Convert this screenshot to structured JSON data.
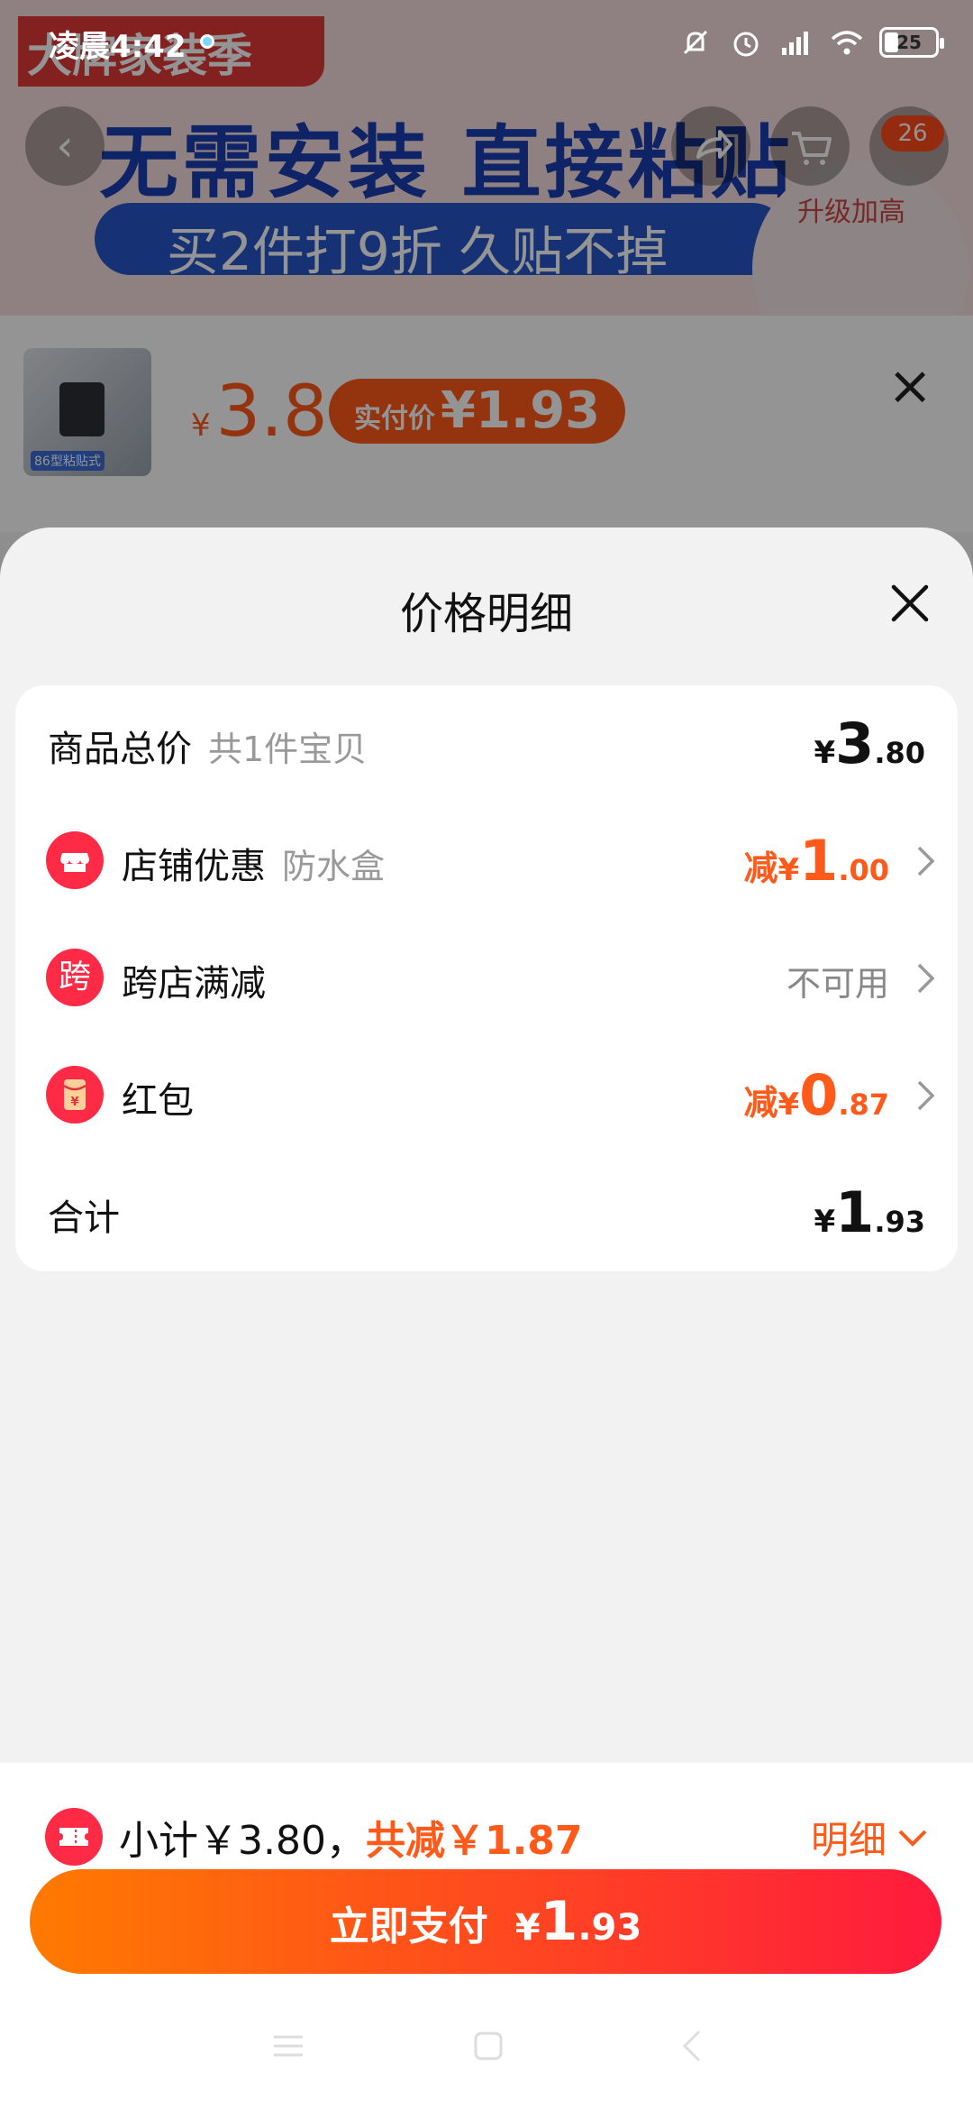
{
  "status_bar": {
    "time": "凌晨4:42",
    "battery": "25"
  },
  "background": {
    "banner_title": "无需安装 直接粘贴",
    "banner_sub": "买2件打9折 久贴不掉",
    "banner_tag": "大牌家装季",
    "upgrade_label": "升级加高",
    "cart_count": "26",
    "thumb_label": "86型粘贴式",
    "price_currency": "¥",
    "price_value": "3.8",
    "pay_label": "实付价",
    "pay_value": "¥1.93"
  },
  "sheet": {
    "title": "价格明细",
    "rows": [
      {
        "label": "商品总价",
        "sub": "共1件宝贝",
        "cur": "¥",
        "int": "3",
        "dec": ".80"
      },
      {
        "icon": "store-icon",
        "label": "店铺优惠",
        "sub": "防水盒",
        "prefix": "减",
        "cur": "¥",
        "int": "1",
        "dec": ".00"
      },
      {
        "icon_text": "跨",
        "label": "跨店满减",
        "value": "不可用"
      },
      {
        "icon": "red-packet-icon",
        "icon_text": "¥",
        "label": "红包",
        "prefix": "减",
        "cur": "¥",
        "int": "0",
        "dec": ".87"
      },
      {
        "label": "合计",
        "cur": "¥",
        "int": "1",
        "dec": ".93"
      }
    ]
  },
  "bottom": {
    "subtotal_text": "小计￥3.80，",
    "discount_text": "共减￥1.87",
    "detail_label": "明细",
    "pay_label": "立即支付",
    "pay_cur": "¥",
    "pay_int": "1",
    "pay_dec": ".93"
  },
  "colors": {
    "accent": "#ff5a1a",
    "brand_red": "#ff2a45",
    "button_start": "#ff7a00",
    "button_end": "#ff1a3d"
  }
}
